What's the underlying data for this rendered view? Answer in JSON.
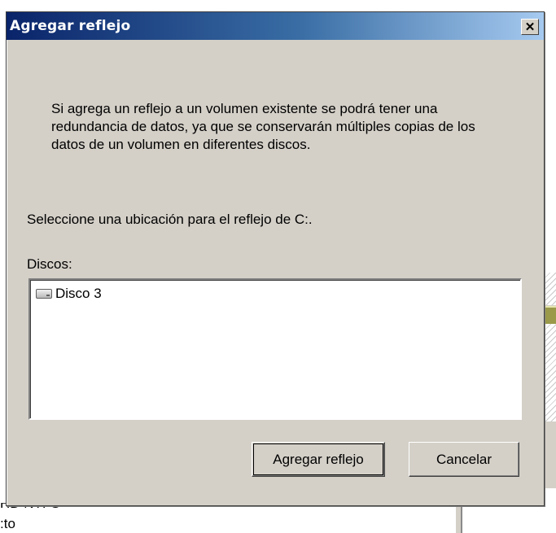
{
  "dialog": {
    "title": "Agregar reflejo",
    "close_label": "✕",
    "description": "Si agrega un reflejo a un volumen existente se podrá tener una redundancia de datos, ya que se conservarán múltiples copias de los datos de un volumen en diferentes discos.",
    "prompt": "Seleccione una ubicación para el reflejo de C:.",
    "disks_label": "Discos:",
    "disks": [
      "Disco 3"
    ],
    "add_button": "Agregar reflejo",
    "cancel_button": "Cancelar"
  },
  "background": {
    "text_1": "HD NTFS",
    "text_2": ":to"
  },
  "colors": {
    "titlebar_start": "#0a246a",
    "titlebar_end": "#a6caf0",
    "dialog_face": "#d4d0c8"
  },
  "icons": {
    "disk": "hard-disk-icon",
    "close": "close-icon"
  }
}
